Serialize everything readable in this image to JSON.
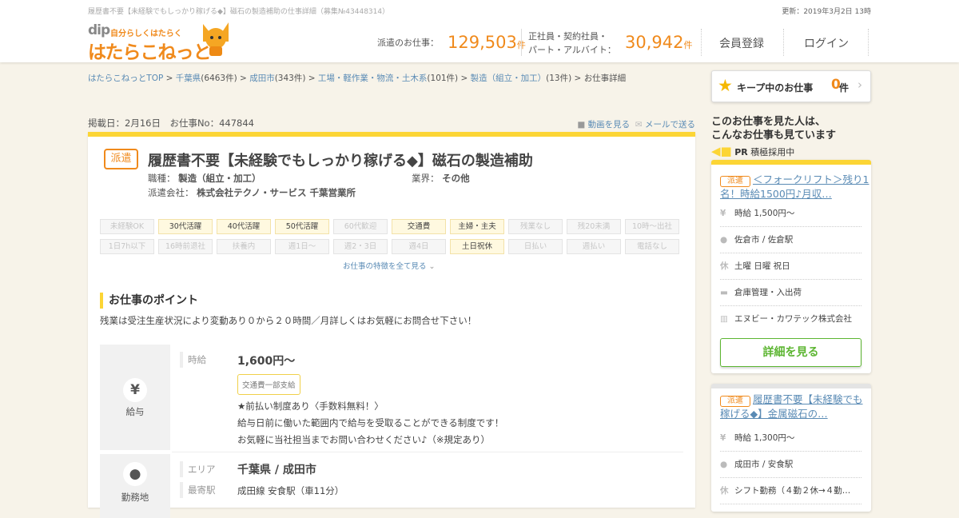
{
  "page_title": "履歴書不要【未経験でもしっかり稼げる◆】磁石の製造補助の仕事詳細（募集№43448314）",
  "updated": "更新：2019年3月2日 13時",
  "logo": {
    "dip": "dip",
    "tagline": "自分らしくはたらく",
    "name": "はたらこねっと"
  },
  "stats": {
    "haken_label": "派遣のお仕事：",
    "haken_count": "129,503",
    "unit": "件",
    "seisha_label1": "正社員・契約社員・",
    "seisha_label2": "パート・アルバイト：",
    "seisha_count": "30,942"
  },
  "nav": {
    "register": "会員登録",
    "login": "ログイン"
  },
  "breadcrumb": [
    {
      "label": "はたらこねっとTOP",
      "count": ""
    },
    {
      "label": "千葉県",
      "count": "(6463件)"
    },
    {
      "label": "成田市",
      "count": "(343件)"
    },
    {
      "label": "工場・軽作業・物流・土木系",
      "count": "(101件)"
    },
    {
      "label": "製造（組立・加工）",
      "count": "(13件)"
    }
  ],
  "breadcrumb_current": "お仕事詳細",
  "keep": {
    "label": "キープ中のお仕事",
    "count": "0",
    "unit": "件"
  },
  "job": {
    "meta": "掲載日：2月16日　お仕事No：447844",
    "video_link": "動画を見る",
    "mail_link": "メールで送る",
    "badge": "派遣",
    "title": "履歴書不要【未経験でもしっかり稼げる◆】磁石の製造補助",
    "type_label": "職種：",
    "type": "製造（組立・加工）",
    "industry_label": "業界：",
    "industry": "その他",
    "company_label": "派遣会社：",
    "company": "株式会社テクノ・サービス 千葉営業所",
    "tags": [
      {
        "t": "未経験OK",
        "on": false
      },
      {
        "t": "30代活躍",
        "on": true
      },
      {
        "t": "40代活躍",
        "on": true
      },
      {
        "t": "50代活躍",
        "on": true
      },
      {
        "t": "60代歓迎",
        "on": false
      },
      {
        "t": "交通費",
        "on": true
      },
      {
        "t": "主婦・主夫",
        "on": true
      },
      {
        "t": "残業なし",
        "on": false
      },
      {
        "t": "残20未満",
        "on": false
      },
      {
        "t": "10時～出社",
        "on": false
      },
      {
        "t": "1日7h以下",
        "on": false
      },
      {
        "t": "16時前退社",
        "on": false
      },
      {
        "t": "扶養内",
        "on": false
      },
      {
        "t": "週1日～",
        "on": false
      },
      {
        "t": "週2・3日",
        "on": false
      },
      {
        "t": "週4日",
        "on": false
      },
      {
        "t": "土日祝休",
        "on": true
      },
      {
        "t": "日払い",
        "on": false
      },
      {
        "t": "週払い",
        "on": false
      },
      {
        "t": "電話なし",
        "on": false
      }
    ],
    "see_all": "お仕事の特徴を全て見る",
    "point_heading": "お仕事のポイント",
    "point_text": "残業は受注生産状況により変動あり０から２０時間／月詳しくはお気軽にお問合せ下さい！",
    "salary": {
      "section": "給与",
      "label": "時給",
      "value": "1,600円～",
      "badge": "交通費一部支給",
      "line1": "★前払い制度あり〈手数料無料！〉",
      "line2": "給与日前に働いた範囲内で給与を受取ることができる制度です！",
      "line3": "お気軽に当社担当までお問い合わせください♪（※規定あり）"
    },
    "location": {
      "section": "勤務地",
      "area_label": "エリア",
      "area": "千葉県 / 成田市",
      "station_label": "最寄駅",
      "station": "成田線 安食駅（車11分）"
    }
  },
  "sidebar": {
    "heading1": "このお仕事を見た人は、",
    "heading2": "こんなお仕事も見ています",
    "pr": "PR",
    "pr_text": "積極採用中",
    "cards": [
      {
        "badge": "派遣",
        "title": "＜フォークリフト＞残り1名！時給1500円♪月収…",
        "pay": "時給 1,500円～",
        "place": "佐倉市 / 佐倉駅",
        "holiday": "土曜 日曜 祝日",
        "job": "倉庫管理・入出荷",
        "company": "エヌビー・カワテック株式会社",
        "button": "詳細を見る"
      },
      {
        "badge": "派遣",
        "title": "履歴書不要【未経験でも稼げる◆】金属磁石の…",
        "pay": "時給 1,300円～",
        "place": "成田市 / 安食駅",
        "holiday": "シフト勤務（４勤２休→４勤…"
      }
    ]
  },
  "colors": {
    "accent": "#f08a1c",
    "yellow": "#fcd535",
    "green": "#5cb531",
    "link": "#5a8bb5"
  }
}
